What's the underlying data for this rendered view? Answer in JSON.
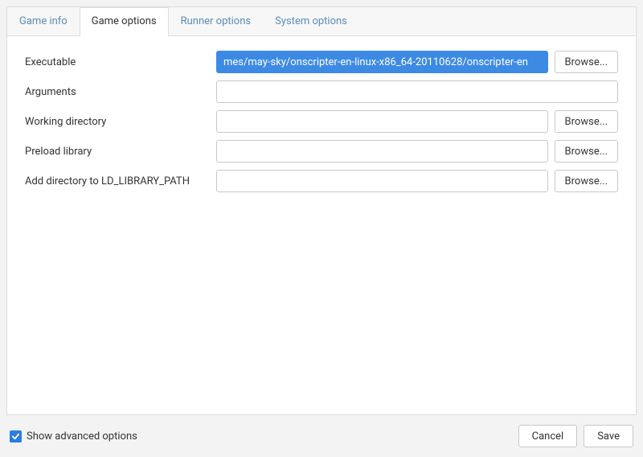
{
  "tabs": {
    "game_info": "Game info",
    "game_options": "Game options",
    "runner_options": "Runner options",
    "system_options": "System options"
  },
  "form": {
    "executable": {
      "label": "Executable",
      "value": "mes/may-sky/onscripter-en-linux-x86_64-20110628/onscripter-en",
      "browse": "Browse..."
    },
    "arguments": {
      "label": "Arguments",
      "value": ""
    },
    "working_directory": {
      "label": "Working directory",
      "value": "",
      "browse": "Browse..."
    },
    "preload_library": {
      "label": "Preload library",
      "value": "",
      "browse": "Browse..."
    },
    "ld_library_path": {
      "label": "Add directory to LD_LIBRARY_PATH",
      "value": "",
      "browse": "Browse..."
    }
  },
  "footer": {
    "show_advanced": "Show advanced options",
    "cancel": "Cancel",
    "save": "Save"
  }
}
